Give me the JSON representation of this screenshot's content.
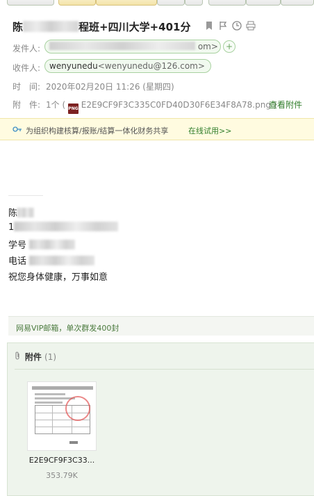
{
  "subject": {
    "prefix": "陈",
    "suffix": "程班+四川大学+401分"
  },
  "header": {
    "from_label": "发件人:",
    "from_email_suffix": "om>",
    "from_add": "+",
    "to_label": "收件人:",
    "to_name": "wenyunedu",
    "to_email": "<wenyunedu@126.com>",
    "time_label": "时　间:",
    "time_value": "2020年02月20日 11:26 (星期四)",
    "attach_label": "附　件:",
    "attach_count": "1个 (",
    "attach_icon_text": "PNG",
    "attach_filename": "E2E9CF9F3C335C0FD40D30F6E34F8A78.png )",
    "attach_view": "查看附件"
  },
  "icons": [
    "bookmark-icon",
    "flag-icon",
    "clock-icon",
    "print-icon"
  ],
  "ad": {
    "text": "为组织构建核算/报账/结算一体化财务共享",
    "link": "在线试用>>"
  },
  "body": {
    "line1_prefix": "陈",
    "line2_prefix": "1",
    "line3_prefix": "学号",
    "line4_prefix": "电话",
    "line5": "祝您身体健康，万事如意"
  },
  "vip_text": "网易VIP邮箱，单次群发400封",
  "attachments": {
    "title": "附件",
    "count": "(1)",
    "items": [
      {
        "name": "E2E9CF9F3C33...",
        "size": "353.79K"
      }
    ]
  },
  "colors": {
    "accent_green": "#2f7d2a",
    "pill_border": "#a8d1a0",
    "ad_bg": "#fffbe0",
    "panel_bg": "#eef4ec"
  }
}
